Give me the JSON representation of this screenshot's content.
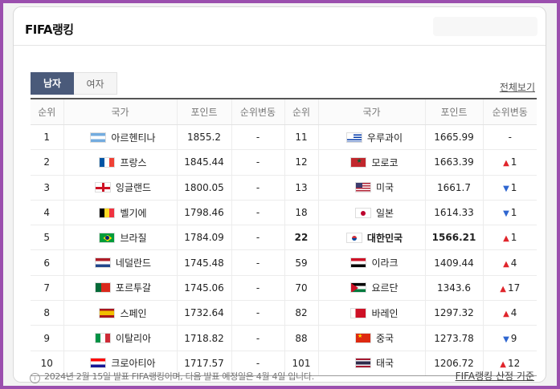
{
  "widget": {
    "title": "FIFA랭킹",
    "tabs": [
      {
        "label": "남자",
        "active": true
      },
      {
        "label": "여자",
        "active": false
      }
    ],
    "view_all": "전체보기",
    "footnote": "2024년 2월 15일 발표 FIFA랭킹이며, 다음 발표 예정일은 4월 4일 입니다.",
    "criteria_link": "FIFA랭킹 산정 기준"
  },
  "table": {
    "headers": [
      "순위",
      "국가",
      "포인트",
      "순위변동",
      "순위",
      "국가",
      "포인트",
      "순위변동"
    ],
    "left": [
      {
        "rank": "1",
        "country": "아르헨티나",
        "flag": "f-ar",
        "points": "1855.2",
        "change": "-",
        "dir": ""
      },
      {
        "rank": "2",
        "country": "프랑스",
        "flag": "f-fr",
        "points": "1845.44",
        "change": "-",
        "dir": ""
      },
      {
        "rank": "3",
        "country": "잉글랜드",
        "flag": "f-en",
        "points": "1800.05",
        "change": "-",
        "dir": ""
      },
      {
        "rank": "4",
        "country": "벨기에",
        "flag": "f-be",
        "points": "1798.46",
        "change": "-",
        "dir": ""
      },
      {
        "rank": "5",
        "country": "브라질",
        "flag": "f-br",
        "points": "1784.09",
        "change": "-",
        "dir": ""
      },
      {
        "rank": "6",
        "country": "네덜란드",
        "flag": "f-nl",
        "points": "1745.48",
        "change": "-",
        "dir": ""
      },
      {
        "rank": "7",
        "country": "포르투갈",
        "flag": "f-pt",
        "points": "1745.06",
        "change": "-",
        "dir": ""
      },
      {
        "rank": "8",
        "country": "스페인",
        "flag": "f-es",
        "points": "1732.64",
        "change": "-",
        "dir": ""
      },
      {
        "rank": "9",
        "country": "이탈리아",
        "flag": "f-it",
        "points": "1718.82",
        "change": "-",
        "dir": ""
      },
      {
        "rank": "10",
        "country": "크로아티아",
        "flag": "f-hr",
        "points": "1717.57",
        "change": "-",
        "dir": ""
      }
    ],
    "right": [
      {
        "rank": "11",
        "country": "우루과이",
        "flag": "f-uy",
        "points": "1665.99",
        "change": "-",
        "dir": ""
      },
      {
        "rank": "12",
        "country": "모로코",
        "flag": "f-ma",
        "points": "1663.39",
        "change": "1",
        "dir": "up"
      },
      {
        "rank": "13",
        "country": "미국",
        "flag": "f-us",
        "points": "1661.7",
        "change": "1",
        "dir": "down"
      },
      {
        "rank": "18",
        "country": "일본",
        "flag": "f-jp",
        "points": "1614.33",
        "change": "1",
        "dir": "down"
      },
      {
        "rank": "22",
        "country": "대한민국",
        "flag": "f-kr",
        "points": "1566.21",
        "change": "1",
        "dir": "up",
        "highlight": true
      },
      {
        "rank": "59",
        "country": "이라크",
        "flag": "f-iq",
        "points": "1409.44",
        "change": "4",
        "dir": "up"
      },
      {
        "rank": "70",
        "country": "요르단",
        "flag": "f-jo",
        "points": "1343.6",
        "change": "17",
        "dir": "up"
      },
      {
        "rank": "82",
        "country": "바레인",
        "flag": "f-bh",
        "points": "1297.32",
        "change": "4",
        "dir": "up"
      },
      {
        "rank": "88",
        "country": "중국",
        "flag": "f-cn",
        "points": "1273.78",
        "change": "9",
        "dir": "down"
      },
      {
        "rank": "101",
        "country": "태국",
        "flag": "f-th",
        "points": "1206.72",
        "change": "12",
        "dir": "up"
      }
    ]
  },
  "icons": {
    "up": "up-arrow-icon",
    "down": "down-arrow-icon",
    "info": "info-icon"
  },
  "colors": {
    "tab_active": "#4a5a7a",
    "up": "#e0252b",
    "down": "#2f66d0",
    "background": "#9b4fae"
  }
}
